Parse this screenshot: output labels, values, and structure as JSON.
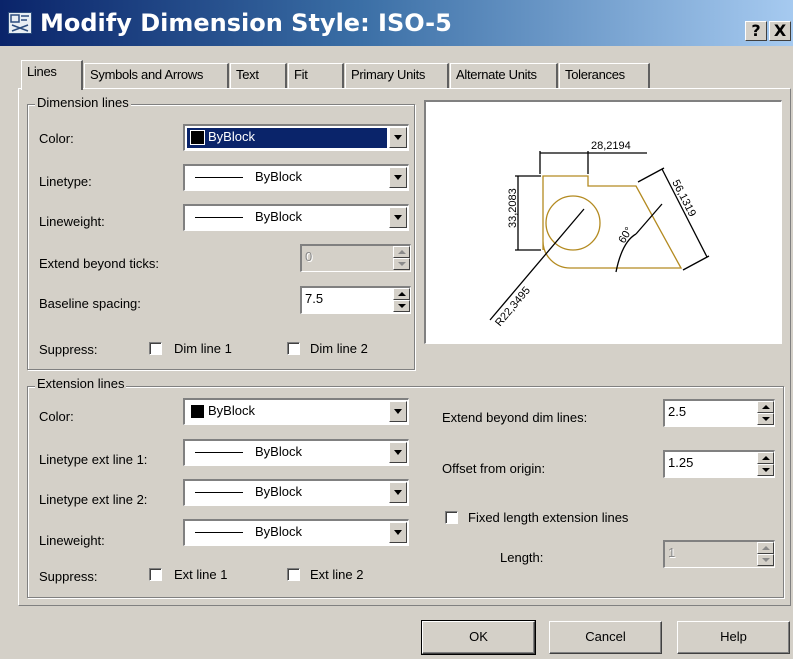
{
  "window": {
    "title": "Modify Dimension Style: ISO-5",
    "help_glyph": "?",
    "close_glyph": "X"
  },
  "tabs": [
    {
      "label": "Lines"
    },
    {
      "label": "Symbols and Arrows"
    },
    {
      "label": "Text"
    },
    {
      "label": "Fit"
    },
    {
      "label": "Primary Units"
    },
    {
      "label": "Alternate Units"
    },
    {
      "label": "Tolerances"
    }
  ],
  "dimension_lines": {
    "legend": "Dimension lines",
    "color_label": "Color:",
    "color_value": "ByBlock",
    "linetype_label": "Linetype:",
    "linetype_value": "ByBlock",
    "lineweight_label": "Lineweight:",
    "lineweight_value": "ByBlock",
    "extend_label": "Extend beyond ticks:",
    "extend_value": "0",
    "baseline_label": "Baseline spacing:",
    "baseline_value": "7.5",
    "suppress_label": "Suppress:",
    "dim_line_1": "Dim line 1",
    "dim_line_2": "Dim line 2"
  },
  "preview": {
    "dim_top": "28,2194",
    "dim_left": "33,2083",
    "dim_right": "56,1319",
    "angle": "60°",
    "radius": "R22,3495"
  },
  "extension_lines": {
    "legend": "Extension lines",
    "color_label": "Color:",
    "color_value": "ByBlock",
    "lt1_label": "Linetype ext line 1:",
    "lt1_value": "ByBlock",
    "lt2_label": "Linetype ext line 2:",
    "lt2_value": "ByBlock",
    "lineweight_label": "Lineweight:",
    "lineweight_value": "ByBlock",
    "suppress_label": "Suppress:",
    "ext_line_1": "Ext line 1",
    "ext_line_2": "Ext line 2",
    "extend_dim_label": "Extend beyond dim lines:",
    "extend_dim_value": "2.5",
    "offset_label": "Offset from origin:",
    "offset_value": "1.25",
    "fixed_label": "Fixed length extension lines",
    "length_label": "Length:",
    "length_value": "1"
  },
  "buttons": {
    "ok": "OK",
    "cancel": "Cancel",
    "help": "Help"
  }
}
